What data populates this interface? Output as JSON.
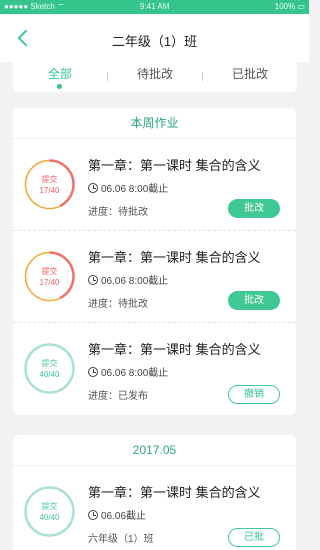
{
  "status_bar": {
    "carrier": "●●●●● Sketch ⌔",
    "time": "9:41 AM",
    "battery": "100% ▭"
  },
  "header": {
    "title": "二年级（1）班"
  },
  "tabs": [
    {
      "label": "全部",
      "active": true
    },
    {
      "label": "待批改",
      "active": false
    },
    {
      "label": "已批改",
      "active": false
    }
  ],
  "sections": [
    {
      "heading": "本周作业",
      "items": [
        {
          "ring_label": "提交",
          "ring_count": "17/40",
          "submitted_fraction": 0.425,
          "ring_color": "#f0a830",
          "arc_color": "#f0706a",
          "text_color": "#f06060",
          "title": "第一章：第一课时 集合的含义",
          "deadline": "06.06 8:00截止",
          "progress": "进度：待批改",
          "button": "批改",
          "button_style": "filled"
        },
        {
          "ring_label": "提交",
          "ring_count": "17/40",
          "submitted_fraction": 0.425,
          "ring_color": "#f0a830",
          "arc_color": "#f0706a",
          "text_color": "#f06060",
          "title": "第一章：第一课时 集合的含义",
          "deadline": "06.06 8:00截止",
          "progress": "进度：待批改",
          "button": "批改",
          "button_style": "filled"
        },
        {
          "ring_label": "提交",
          "ring_count": "40/40",
          "submitted_fraction": 1.0,
          "ring_color": "#a6e4c9",
          "arc_color": "#a6e4c9",
          "text_color": "#3fc894",
          "title": "第一章：第一课时 集合的含义",
          "deadline": "06.06 8:00截止",
          "progress": "进度：已发布",
          "button": "撤销",
          "button_style": "outline"
        }
      ]
    },
    {
      "heading": "2017.05",
      "items": [
        {
          "ring_label": "提交",
          "ring_count": "40/40",
          "submitted_fraction": 1.0,
          "ring_color": "#a6e4c9",
          "arc_color": "#a6e4c9",
          "text_color": "#3fc894",
          "title": "第一章：第一课时 集合的含义",
          "deadline": "06.06截止",
          "progress": "六年级（1）班",
          "button": "已批",
          "button_style": "outline"
        }
      ]
    }
  ]
}
